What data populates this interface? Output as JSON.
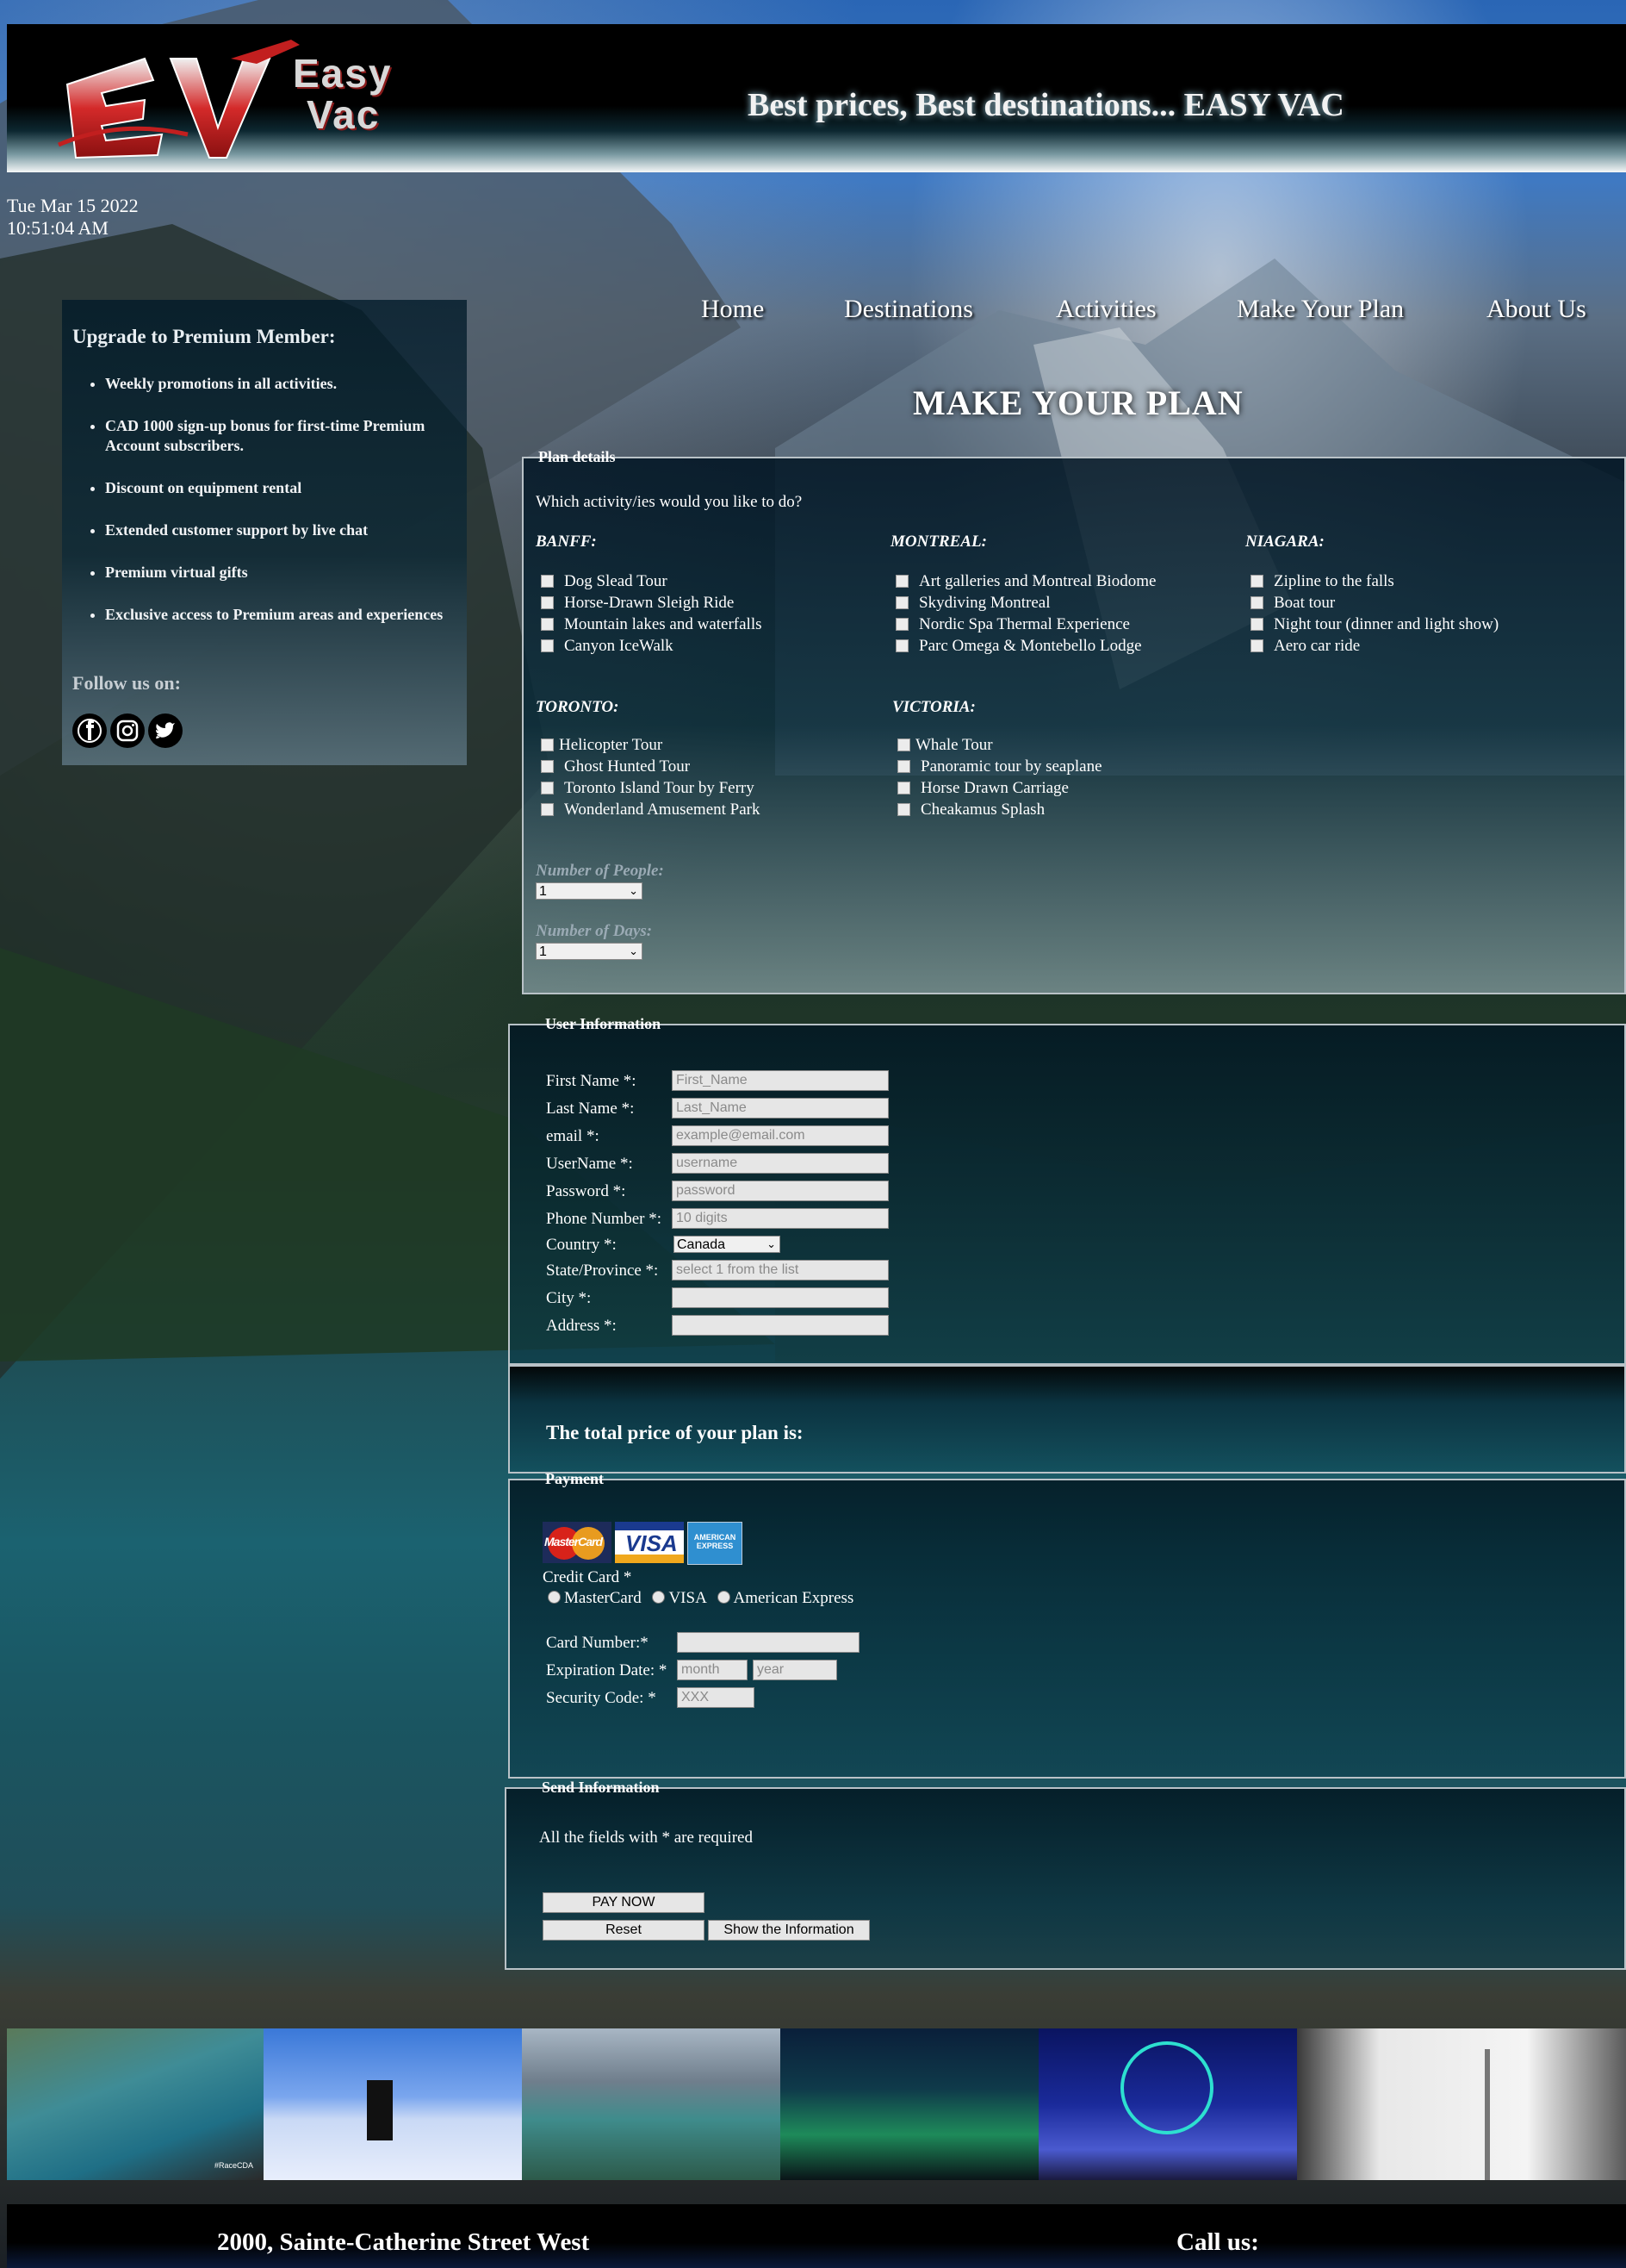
{
  "header": {
    "logo_initials": "EV",
    "logo_word1": "Easy",
    "logo_word2": "Vac",
    "tagline": "Best prices, Best destinations... EASY VAC"
  },
  "datetime": {
    "date": "Tue Mar 15 2022",
    "time": "10:51:04 AM"
  },
  "sidebar": {
    "title": "Upgrade to Premium Member:",
    "items": [
      "Weekly promotions in all activities.",
      "CAD 1000 sign-up bonus for first-time Premium Account subscribers.",
      "Discount on equipment rental",
      "Extended customer support by live chat",
      "Premium virtual gifts",
      "Exclusive access to Premium areas and experiences"
    ],
    "follow": "Follow us on:",
    "social_icons": [
      "facebook-icon",
      "instagram-icon",
      "twitter-icon"
    ]
  },
  "nav": [
    "Home",
    "Destinations",
    "Activities",
    "Make Your Plan",
    "About Us"
  ],
  "page_title": "MAKE YOUR PLAN",
  "plan": {
    "legend": "Plan details",
    "question": "Which activity/ies would you like to do?",
    "regions": [
      {
        "name": "BANFF:",
        "items": [
          "Dog Slead Tour",
          "Horse-Drawn Sleigh Ride",
          "Mountain lakes and waterfalls",
          "Canyon IceWalk"
        ]
      },
      {
        "name": "MONTREAL:",
        "items": [
          "Art galleries and Montreal Biodome",
          "Skydiving Montreal",
          "Nordic Spa Thermal Experience",
          "Parc Omega & Montebello Lodge"
        ]
      },
      {
        "name": "NIAGARA:",
        "items": [
          "Zipline to the falls",
          "Boat tour",
          "Night tour (dinner and light show)",
          "Aero car ride"
        ]
      },
      {
        "name": "TORONTO:",
        "items": [
          "Helicopter Tour",
          "Ghost Hunted Tour",
          "Toronto Island Tour by Ferry",
          "Wonderland Amusement Park"
        ]
      },
      {
        "name": "VICTORIA:",
        "items": [
          "Whale Tour",
          "Panoramic tour by seaplane",
          "Horse Drawn Carriage",
          "Cheakamus Splash"
        ]
      }
    ],
    "people_label": "Number of People:",
    "people_value": "1",
    "days_label": "Number of Days:",
    "days_value": "1"
  },
  "user": {
    "legend": "User Information",
    "fields": [
      {
        "label": "First Name *:",
        "placeholder": "First_Name"
      },
      {
        "label": "Last Name *:",
        "placeholder": "Last_Name"
      },
      {
        "label": "email *:",
        "placeholder": "example@email.com"
      },
      {
        "label": "UserName *:",
        "placeholder": "username"
      },
      {
        "label": "Password *:",
        "placeholder": "password"
      },
      {
        "label": "Phone Number *:",
        "placeholder": "10 digits"
      },
      {
        "label": "Country *:",
        "placeholder": "Canada"
      },
      {
        "label": "State/Province *:",
        "placeholder": "select 1 from the list"
      },
      {
        "label": "City *:",
        "placeholder": ""
      },
      {
        "label": "Address *:",
        "placeholder": ""
      }
    ]
  },
  "total": {
    "label": "The total price of your plan is:"
  },
  "payment": {
    "legend": "Payment",
    "cards": [
      "MasterCard",
      "VISA",
      "AMERICAN EXPRESS"
    ],
    "credit_label": "Credit Card *",
    "options": [
      "MasterCard",
      "VISA",
      "American Express"
    ],
    "card_number_label": "Card Number:*",
    "expiration_label": "Expiration Date: *",
    "month_placeholder": "month",
    "year_placeholder": "year",
    "security_label": "Security Code: *",
    "security_placeholder": "XXX"
  },
  "send": {
    "legend": "Send Information",
    "note": "All the fields with * are required",
    "pay_now": "PAY NOW",
    "reset": "Reset",
    "show_info": "Show the Information"
  },
  "gallery_badge": "#RaceCDA",
  "footer": {
    "address": "2000, Sainte-Catherine Street West",
    "call": "Call us:"
  }
}
